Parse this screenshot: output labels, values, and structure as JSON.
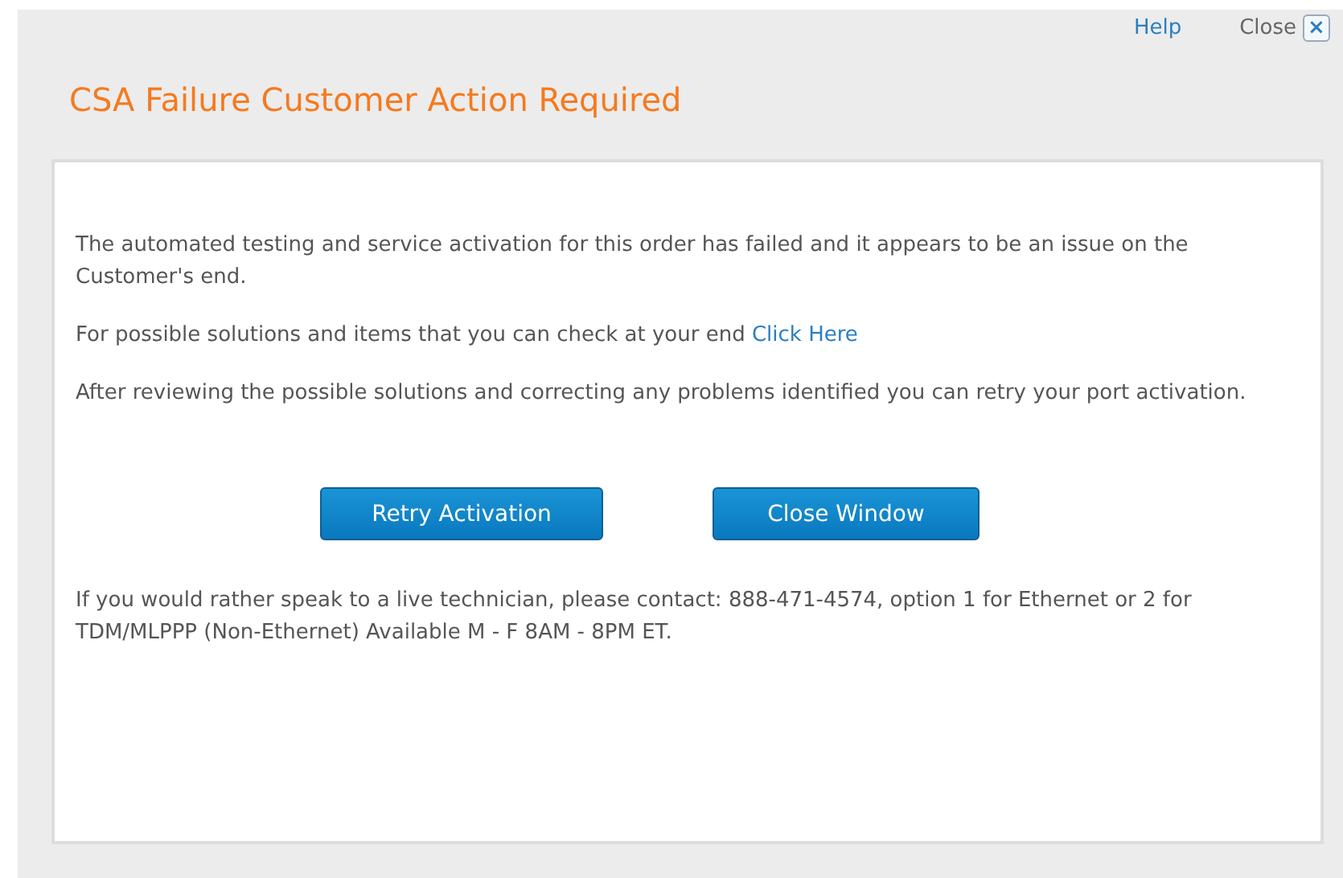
{
  "header_links": [
    {
      "kind": "link",
      "label": "Help"
    },
    {
      "kind": "close",
      "label": "Close",
      "icon": "×"
    }
  ],
  "title": "CSA Failure Customer Action Required",
  "paragraphs": [
    {
      "text": "The automated testing and service activation for this order has failed and it appears to be an issue on the Customer's end."
    },
    {
      "text": "For possible solutions and items that you can check at your end",
      "link": "Click Here"
    },
    {
      "text": "After reviewing the possible solutions and correcting any problems identified you can retry your port activation."
    }
  ],
  "buttons": [
    "Retry Activation",
    "Close Window"
  ],
  "footer_note": "If you would rather speak to a live technician, please contact: 888-471-4574, option 1 for Ethernet or 2 for TDM/MLPPP (Non-Ethernet) Available M - F 8AM - 8PM ET."
}
